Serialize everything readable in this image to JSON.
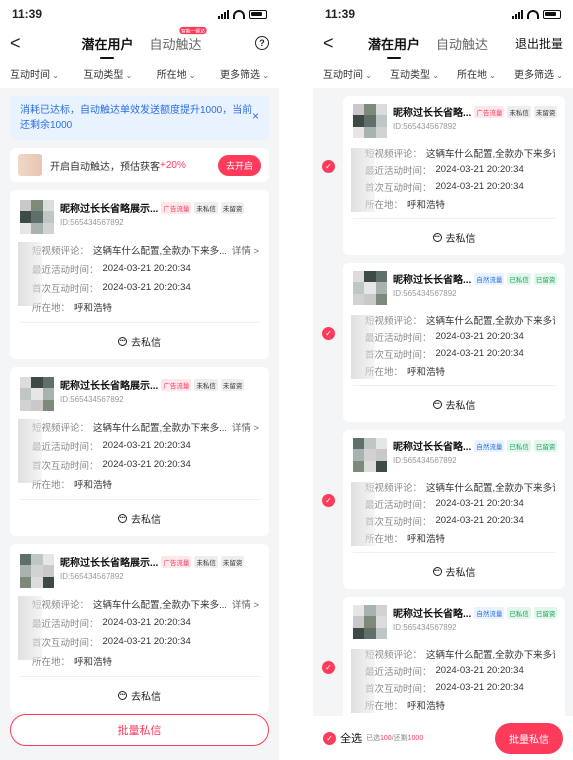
{
  "status": {
    "time": "11:39"
  },
  "nav": {
    "back": "<",
    "tab_potential": "潜在用户",
    "tab_auto": "自动触达",
    "tab_auto_flag": "智能一键达",
    "help": "?",
    "exit_batch": "退出批量"
  },
  "filters": {
    "interact_time": "互动时间",
    "interact_type": "互动类型",
    "location": "所在地",
    "more": "更多筛选"
  },
  "notice": {
    "text": "消耗已达标，自动触达单效发送额度提升1000，当前还剩余1000",
    "close": "×"
  },
  "auto_bar": {
    "text": "开启自动触达，预估获客",
    "percent": "+20%",
    "button": "去开启"
  },
  "labels": {
    "comment": "短视频评论：",
    "recent": "最近活动时间：",
    "first": "首次互动时间：",
    "location": "所在地：",
    "detail": "详情 >",
    "dm": "去私信"
  },
  "left_cards": [
    {
      "name": "昵称过长长省略展示...",
      "uid": "ID:565434567892",
      "tags": [
        "广告流量",
        "未私信",
        "未留资"
      ],
      "comment": "这辆车什么配置,全款办下来多...",
      "recent": "2024-03-21  20:20:34",
      "first": "2024-03-21  20:20:34",
      "location": "呼和浩特"
    },
    {
      "name": "昵称过长长省略展示...",
      "uid": "ID:565434567892",
      "tags": [
        "广告流量",
        "未私信",
        "未留资"
      ],
      "comment": "这辆车什么配置,全款办下来多...",
      "recent": "2024-03-21  20:20:34",
      "first": "2024-03-21  20:20:34",
      "location": "呼和浩特"
    },
    {
      "name": "昵称过长长省略展示...",
      "uid": "ID:565434567892",
      "tags": [
        "广告流量",
        "未私信",
        "未留资"
      ],
      "comment": "这辆车什么配置,全款办下来多...",
      "recent": "2024-03-21  20:20:34",
      "first": "2024-03-21  20:20:34",
      "location": "呼和浩特"
    }
  ],
  "right_cards": [
    {
      "name": "昵称过长长省略...",
      "uid": "ID:565434567892",
      "tags": [
        "广告流量",
        "未私信",
        "未留资"
      ],
      "comment": "这辆车什么配置,全款办下来多详情 >",
      "recent": "2024-03-21  20:20:34",
      "first": "2024-03-21  20:20:34",
      "location": "呼和浩特"
    },
    {
      "name": "昵称过长长省略...",
      "uid": "ID:565434567892",
      "tags": [
        "自然流量",
        "已私信",
        "已留资"
      ],
      "comment": "这辆车什么配置,全款办下来多详情 >",
      "recent": "2024-03-21  20:20:34",
      "first": "2024-03-21  20:20:34",
      "location": "呼和浩特"
    },
    {
      "name": "昵称过长长省略...",
      "uid": "ID:565434567892",
      "tags": [
        "自然流量",
        "已私信",
        "已留资"
      ],
      "comment": "这辆车什么配置,全款办下来多详情 >",
      "recent": "2024-03-21  20:20:34",
      "first": "2024-03-21  20:20:34",
      "location": "呼和浩特"
    },
    {
      "name": "昵称过长长省略...",
      "uid": "ID:565434567892",
      "tags": [
        "自然流量",
        "已私信",
        "已留资"
      ],
      "comment": "这辆车什么配置,全款办下来多详情 >",
      "recent": "2024-03-21  20:20:34",
      "first": "2024-03-21  20:20:34",
      "location": "呼和浩特"
    }
  ],
  "bulk_left": "批量私信",
  "bottom": {
    "check": "✓",
    "select_all": "全选",
    "count_prefix": "已选",
    "count_selected": "100",
    "count_mid": "/还剩",
    "count_remaining": "1000",
    "bulk": "批量私信"
  },
  "colors": {
    "accent": "#ff3b5c",
    "info": "#2d6fe0",
    "success": "#17a35a"
  }
}
